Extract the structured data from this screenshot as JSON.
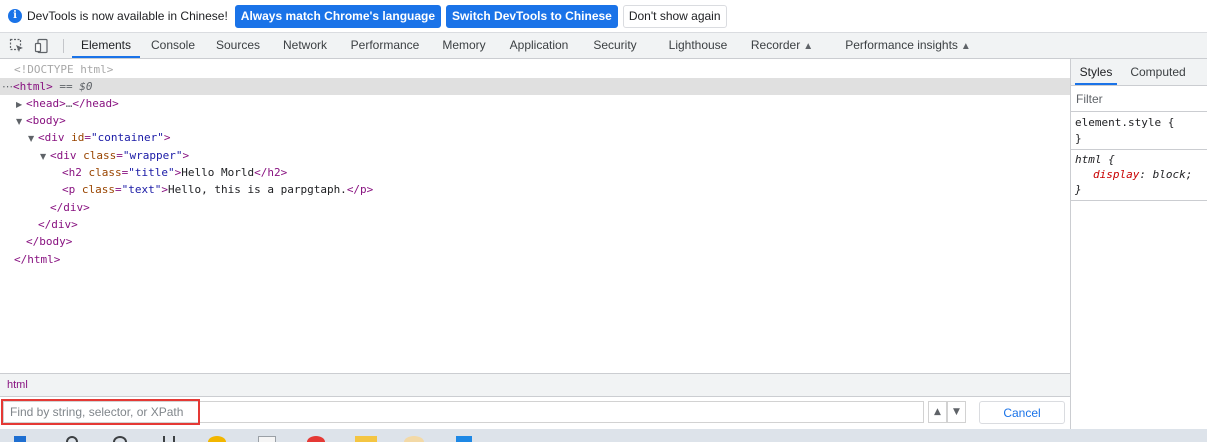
{
  "infobar": {
    "message": "DevTools is now available in Chinese!",
    "buttons": {
      "match": "Always match Chrome's language",
      "switch": "Switch DevTools to Chinese",
      "dismiss": "Don't show again"
    }
  },
  "tabs": [
    {
      "label": "Elements",
      "active": true
    },
    {
      "label": "Console"
    },
    {
      "label": "Sources"
    },
    {
      "label": "Network"
    },
    {
      "label": "Performance"
    },
    {
      "label": "Memory"
    },
    {
      "label": "Application"
    },
    {
      "label": "Security"
    },
    {
      "label": "Lighthouse"
    },
    {
      "label": "Recorder",
      "experimental": true
    },
    {
      "label": "Performance insights",
      "experimental": true
    }
  ],
  "dom": {
    "doctype": "<!DOCTYPE html>",
    "html_open": "<html>",
    "selected_marker": "== $0",
    "head_open": "<head>",
    "ellipsis": "…",
    "head_close": "</head>",
    "body_open": "<body>",
    "div_tag": "div",
    "id_attr": "id",
    "container_val": "\"container\"",
    "class_attr": "class",
    "wrapper_val": "\"wrapper\"",
    "h2_tag": "h2",
    "title_val": "\"title\"",
    "h2_text": "Hello Morld",
    "h2_close": "</h2>",
    "p_tag": "p",
    "text_val": "\"text\"",
    "p_text": "Hello, this is a parpgtaph.",
    "p_close": "</p>",
    "div_close": "</div>",
    "body_close": "</body>",
    "html_close": "</html>"
  },
  "breadcrumb": "html",
  "search": {
    "placeholder": "Find by string, selector, or XPath",
    "value": "",
    "cancel": "Cancel"
  },
  "styles": {
    "tabs": [
      "Styles",
      "Computed"
    ],
    "filter_placeholder": "Filter",
    "rules": [
      {
        "selector": "element.style {",
        "close": "}"
      },
      {
        "selector": "html {",
        "property": "display",
        "value": "block;",
        "close": "}"
      }
    ]
  },
  "colors": {
    "accent": "#1a73e8",
    "tag": "#881280",
    "attr_name": "#994500",
    "attr_value": "#1a1aa6",
    "highlight": "#e53935"
  }
}
